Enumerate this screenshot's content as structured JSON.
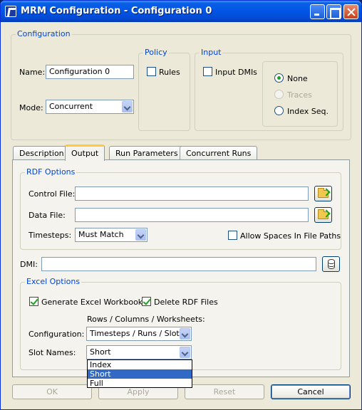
{
  "window": {
    "title": "MRM Configuration - Configuration 0"
  },
  "configuration": {
    "group_title": "Configuration",
    "name_label": "Name:",
    "name_value": "Configuration 0",
    "mode_label": "Mode:",
    "mode_value": "Concurrent"
  },
  "policy": {
    "group_title": "Policy",
    "rules_label": "Rules",
    "rules_checked": false
  },
  "input": {
    "group_title": "Input",
    "input_dmis_label": "Input DMIs",
    "input_dmis_checked": false,
    "radios": [
      {
        "label": "None",
        "checked": true,
        "enabled": true
      },
      {
        "label": "Traces",
        "checked": false,
        "enabled": false
      },
      {
        "label": "Index Seq.",
        "checked": false,
        "enabled": true
      }
    ]
  },
  "tabs": [
    {
      "label": "Description",
      "active": false
    },
    {
      "label": "Output",
      "active": true
    },
    {
      "label": "Run Parameters",
      "active": false
    },
    {
      "label": "Concurrent Runs",
      "active": false
    }
  ],
  "rdf_options": {
    "group_title": "RDF Options",
    "control_file_label": "Control File:",
    "control_file_value": "",
    "data_file_label": "Data File:",
    "data_file_value": "",
    "timesteps_label": "Timesteps:",
    "timesteps_value": "Must Match",
    "allow_spaces_label": "Allow Spaces In File Paths",
    "allow_spaces_checked": false
  },
  "dmi": {
    "label": "DMI:",
    "value": ""
  },
  "excel_options": {
    "group_title": "Excel Options",
    "generate_workbooks_label": "Generate Excel Workbooks",
    "generate_workbooks_checked": true,
    "delete_rdf_label": "Delete RDF Files",
    "delete_rdf_checked": true,
    "rows_columns_header": "Rows / Columns / Worksheets:",
    "configuration_label": "Configuration:",
    "configuration_value": "Timesteps / Runs / Slots",
    "slot_names_label": "Slot Names:",
    "slot_names_value": "Short",
    "slot_names_options": [
      "Index",
      "Short",
      "Full"
    ],
    "slot_names_highlighted": "Short"
  },
  "buttons": {
    "ok": "OK",
    "apply": "Apply",
    "reset": "Reset",
    "cancel": "Cancel"
  }
}
